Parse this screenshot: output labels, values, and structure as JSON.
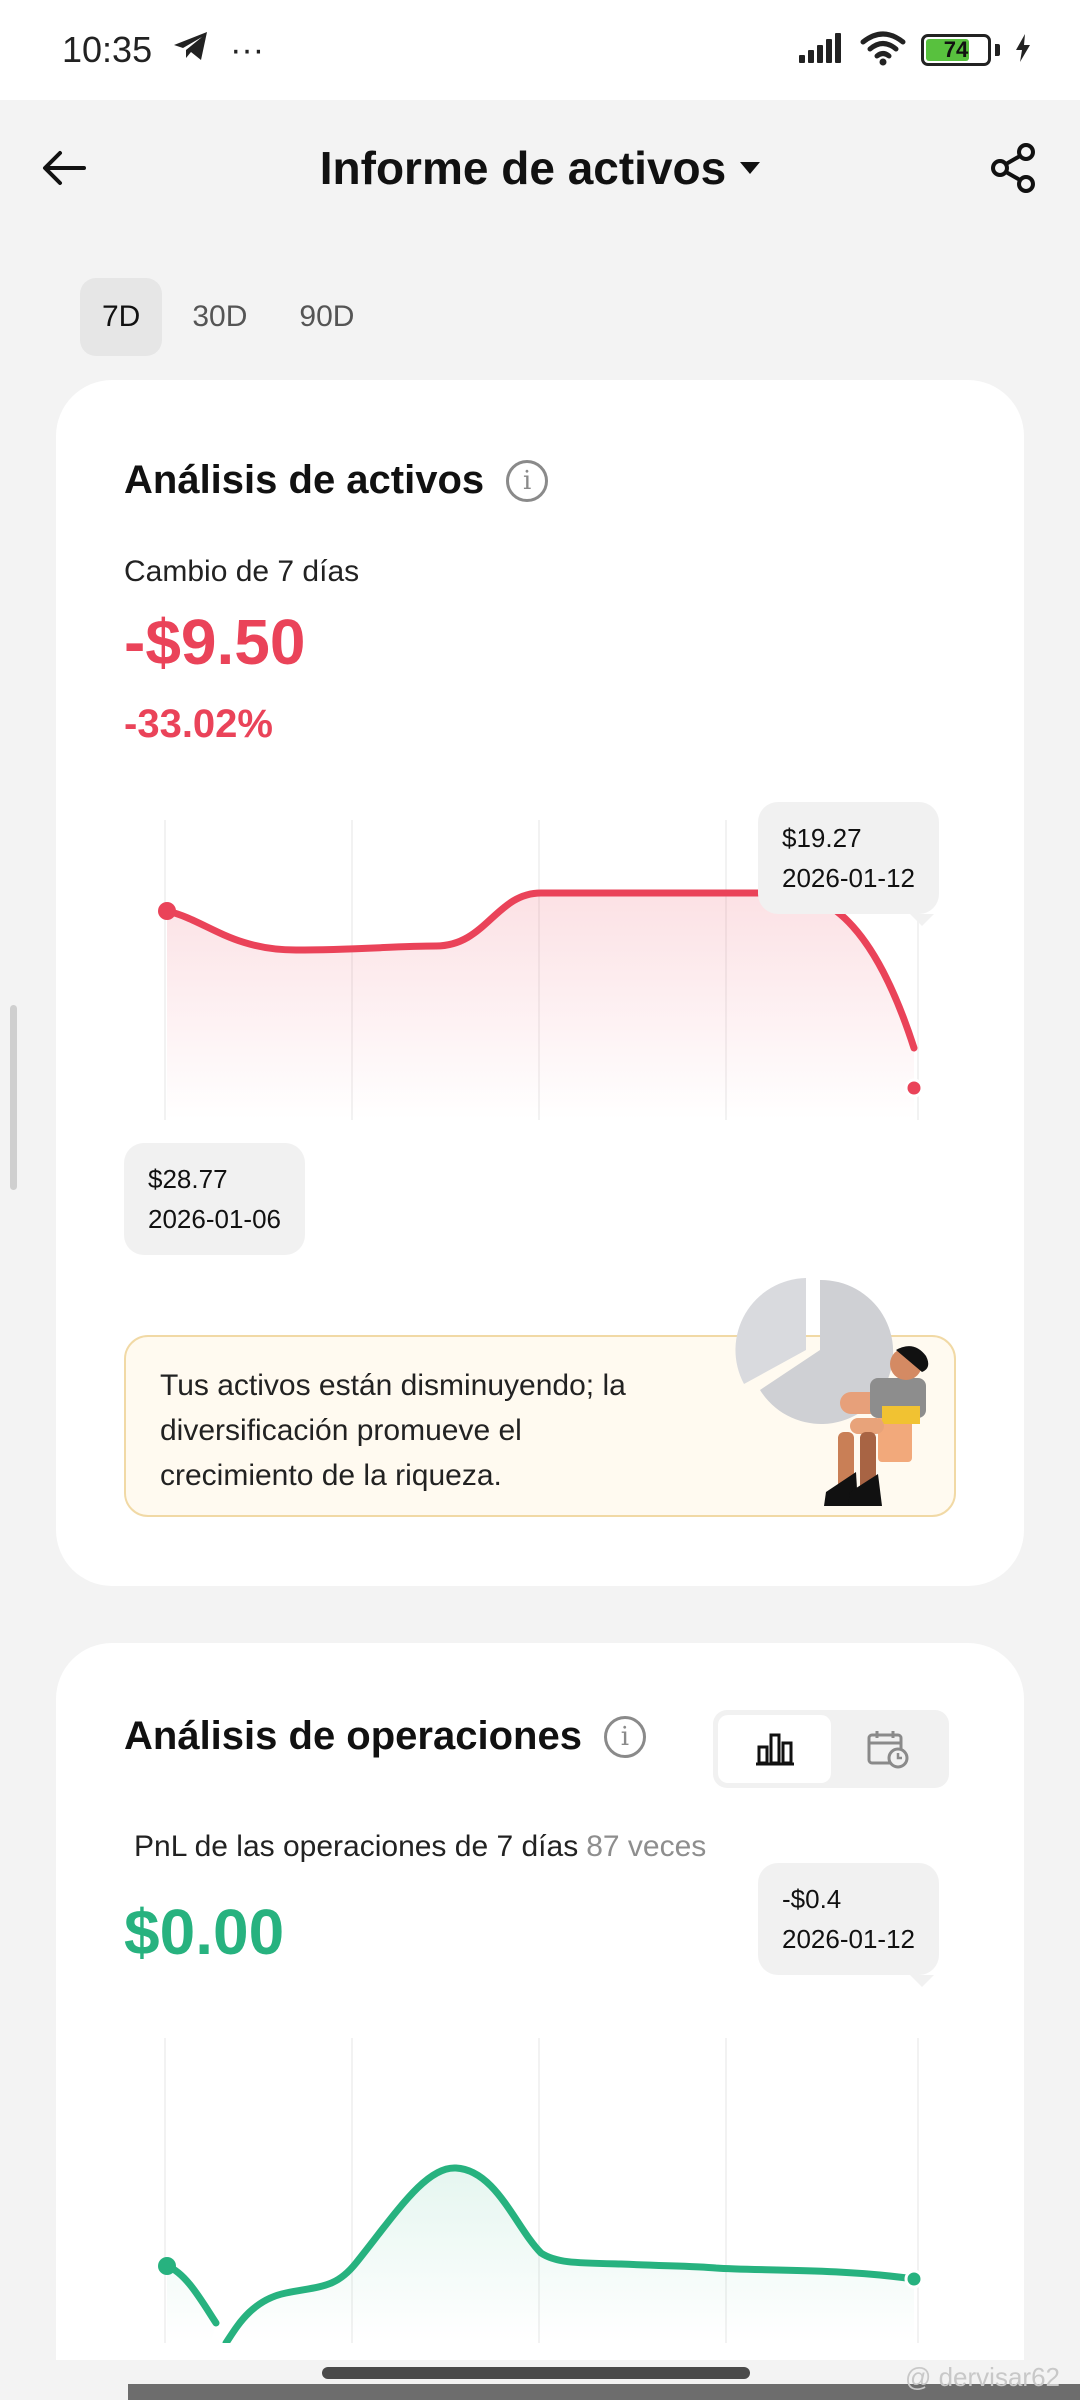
{
  "status_bar": {
    "time": "10:35",
    "more": "···",
    "battery": "74",
    "battery_level": 0.74,
    "icons": [
      "telegram-icon",
      "signal-icon",
      "wifi-icon",
      "battery-icon",
      "charging-icon"
    ]
  },
  "header": {
    "title": "Informe de activos",
    "icons": [
      "back-arrow-icon",
      "caret-down-icon",
      "share-icon"
    ]
  },
  "period_tabs": [
    {
      "label": "7D",
      "active": true
    },
    {
      "label": "30D",
      "active": false
    },
    {
      "label": "90D",
      "active": false
    }
  ],
  "assets": {
    "title": "Análisis de activos",
    "change_label": "Cambio de 7 días",
    "change_value": "-$9.50",
    "change_percent": "-33.02%",
    "tooltip_end": {
      "value": "$19.27",
      "date": "2026-01-12"
    },
    "tooltip_start": {
      "value": "$28.77",
      "date": "2026-01-06"
    },
    "tip": "Tus activos están disminuyendo; la diversificación promueve el crecimiento de la riqueza.",
    "colors": {
      "negative": "#ea4359",
      "tip_bg": "#fffaf0",
      "tip_border": "#f1d9a5"
    }
  },
  "operations": {
    "title": "Análisis de operaciones",
    "pnl_label": "PnL de las operaciones de 7 días",
    "count": "87 veces",
    "pnl_value": "$0.00",
    "tooltip_end": {
      "value": "-$0.4",
      "date": "2026-01-12"
    },
    "view_icons": [
      "bar-chart-icon",
      "calendar-clock-icon"
    ],
    "colors": {
      "positive": "#27b27f"
    }
  },
  "watermark": "@ dervisar62"
}
